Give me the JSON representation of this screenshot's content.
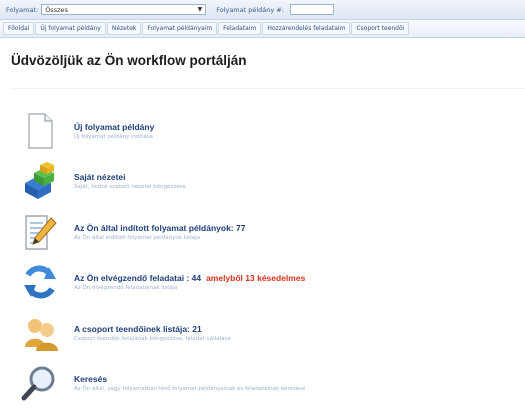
{
  "topbar": {
    "process_label": "Folyamat:",
    "process_value": "Összes",
    "instance_label": "Folyamat példány #:",
    "instance_value": ""
  },
  "tabs": [
    "Főoldal",
    "Új folyamat példány",
    "Nézetek",
    "Folyamat példányaim",
    "Feladataim",
    "Hozzárendelés feladataim",
    "Csoport teendői"
  ],
  "page_title": "Üdvözöljük az Ön workflow portálján",
  "items": [
    {
      "icon": "document-icon",
      "title": "Új folyamat példány",
      "subtitle": "Új folyamat példány indítása"
    },
    {
      "icon": "views-icon",
      "title": "Saját nézetei",
      "subtitle": "Saját, testre szabott nézetei böngészése"
    },
    {
      "icon": "edit-document-icon",
      "title": "Az Ön által indított folyamat példányok: 77",
      "subtitle": "Az Ön által indított folyamat példányok listája"
    },
    {
      "icon": "refresh-icon",
      "title": "Az Ön elvégzendő feladatai : 44",
      "alert": "amelyből 13 késedelmes",
      "subtitle": "Az Ön elvégzendő feladatainak listája"
    },
    {
      "icon": "group-icon",
      "title": "A csoport teendőinek listája: 21",
      "subtitle": "Csoport teendők listájának böngészése, feladat vállalása"
    },
    {
      "icon": "search-icon",
      "title": "Keresés",
      "subtitle": "Az Ön által, vagy folyamatban lévő folyamat példányainak és feladatainak keresése"
    }
  ],
  "colors": {
    "link": "#1f3f7a",
    "alert": "#d8301c"
  }
}
